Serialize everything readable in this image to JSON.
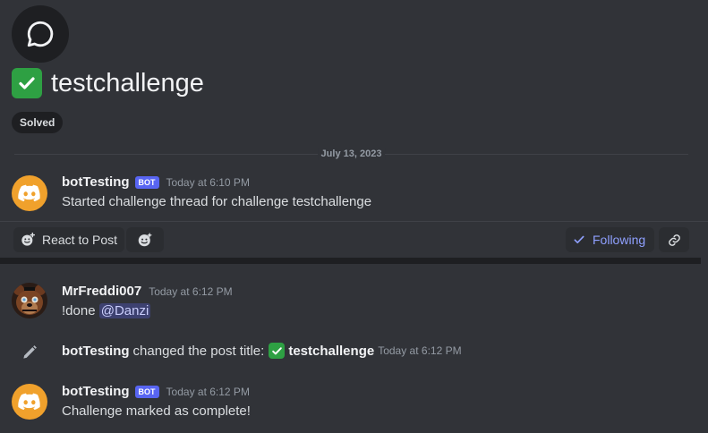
{
  "thread": {
    "title": "testchallenge",
    "tag": "Solved"
  },
  "divider": {
    "date": "July 13, 2023"
  },
  "messages": [
    {
      "username": "botTesting",
      "bot_tag": "BOT",
      "timestamp": "Today at 6:10 PM",
      "body": "Started challenge thread for challenge testchallenge"
    },
    {
      "username": "MrFreddi007",
      "timestamp": "Today at 6:12 PM",
      "body_prefix": "!done",
      "mention": "@Danzi"
    },
    {
      "username": "botTesting",
      "bot_tag": "BOT",
      "timestamp": "Today at 6:12 PM",
      "body": "Challenge marked as complete!"
    }
  ],
  "system_message": {
    "actor": "botTesting",
    "action": "changed the post title:",
    "new_title": "testchallenge",
    "timestamp": "Today at 6:12 PM"
  },
  "actions": {
    "react_label": "React to Post",
    "following_label": "Following"
  },
  "colors": {
    "background": "#313338",
    "bot_tag": "#5865f2",
    "bot_avatar": "#f0a12c",
    "check_green": "#2ea043",
    "following": "#8fa0ff"
  },
  "icons": [
    "chat-bubble-icon",
    "check-mark-icon",
    "discord-logo-icon",
    "emoji-add-icon",
    "super-reaction-icon",
    "check-icon",
    "link-icon",
    "pencil-icon"
  ]
}
